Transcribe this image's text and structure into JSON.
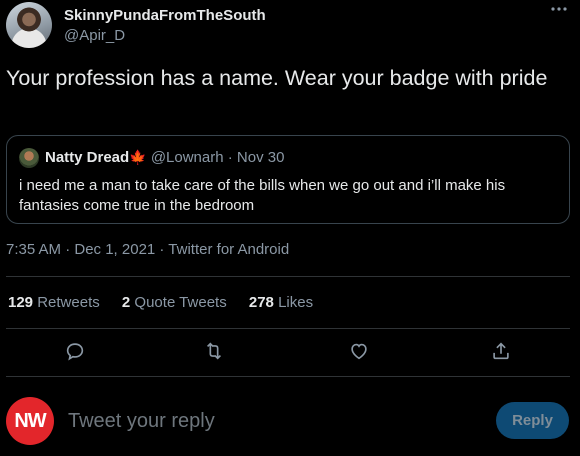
{
  "author": {
    "display_name": "SkinnyPundaFromTheSouth",
    "handle": "@Apir_D"
  },
  "tweet": {
    "text": "Your profession has a name. Wear your badge with pride",
    "timestamp": "7:35 AM · Dec 1, 2021 · Twitter for Android"
  },
  "quoted_tweet": {
    "display_name": "Natty Dread",
    "flag": "🍁",
    "handle_date": "@Lownarh · Nov 30",
    "text": "i need me a man to take care of the bills when we go out and i’ll make his fantasies come true in the bedroom"
  },
  "stats": {
    "retweets_count": "129",
    "retweets_label": "Retweets",
    "quotes_count": "2",
    "quotes_label": "Quote Tweets",
    "likes_count": "278",
    "likes_label": "Likes"
  },
  "actions": {
    "reply_icon": "comment-icon",
    "retweet_icon": "retweet-icon",
    "like_icon": "heart-icon",
    "share_icon": "share-icon"
  },
  "reply_bar": {
    "avatar_text": "NW",
    "placeholder": "Tweet your reply",
    "button_label": "Reply"
  },
  "colors": {
    "background": "#000000",
    "secondary_text": "#8b98a5",
    "reply_button": "#0e4a74",
    "avatar_red": "#e3262b"
  }
}
